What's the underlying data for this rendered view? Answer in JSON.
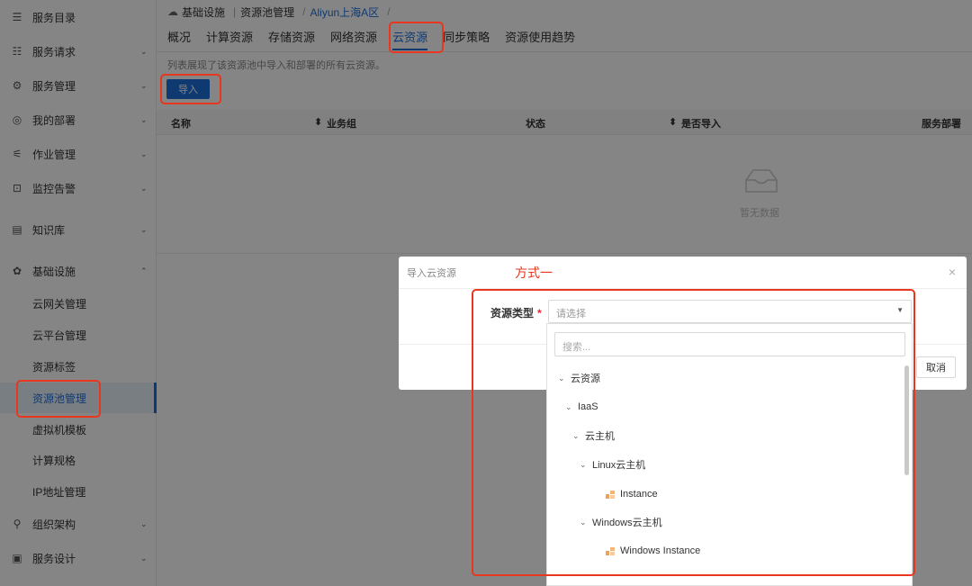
{
  "sidebar": {
    "items": [
      {
        "label": "服务目录",
        "icon": "catalog-icon",
        "chevron": ""
      },
      {
        "label": "服务请求",
        "icon": "request-icon",
        "chevron": "⌄"
      },
      {
        "label": "服务管理",
        "icon": "service-manage-icon",
        "chevron": "⌄"
      },
      {
        "label": "我的部署",
        "icon": "deploy-icon",
        "chevron": "⌄"
      },
      {
        "label": "作业管理",
        "icon": "job-icon",
        "chevron": "⌄"
      },
      {
        "label": "监控告警",
        "icon": "monitor-icon",
        "chevron": "⌄"
      },
      {
        "label": "知识库",
        "icon": "knowledge-icon",
        "chevron": "⌄"
      },
      {
        "label": "基础设施",
        "icon": "infra-icon",
        "chevron": "⌃"
      }
    ],
    "sub_items": [
      {
        "label": "云网关管理"
      },
      {
        "label": "云平台管理"
      },
      {
        "label": "资源标签"
      },
      {
        "label": "资源池管理"
      },
      {
        "label": "虚拟机模板"
      },
      {
        "label": "计算规格"
      },
      {
        "label": "IP地址管理"
      }
    ],
    "bottom_items": [
      {
        "label": "组织架构",
        "icon": "org-icon",
        "chevron": "⌄"
      },
      {
        "label": "服务设计",
        "icon": "design-icon",
        "chevron": "⌄"
      }
    ]
  },
  "breadcrumb": {
    "root": "基础设施",
    "level2": "资源池管理",
    "level3": "Aliyun上海A区",
    "trail_sep": "/"
  },
  "tabs": [
    {
      "label": "概况"
    },
    {
      "label": "计算资源"
    },
    {
      "label": "存储资源"
    },
    {
      "label": "网络资源"
    },
    {
      "label": "云资源"
    },
    {
      "label": "同步策略"
    },
    {
      "label": "资源使用趋势"
    }
  ],
  "description": "列表展现了该资源池中导入和部署的所有云资源。",
  "import_button": "导入",
  "table": {
    "columns": [
      "名称",
      "业务组",
      "状态",
      "是否导入",
      "服务部署"
    ],
    "empty_text": "暂无数据"
  },
  "modal": {
    "title": "导入云资源",
    "close": "×",
    "field_label": "资源类型",
    "required_mark": "*",
    "select_placeholder": "请选择",
    "cancel": "取消"
  },
  "dropdown": {
    "search_placeholder": "搜索...",
    "tree": [
      {
        "label": "云资源",
        "arrow": "⌄"
      },
      {
        "label": "IaaS",
        "arrow": "⌄"
      },
      {
        "label": "云主机",
        "arrow": "⌄"
      },
      {
        "label": "Linux云主机",
        "arrow": "⌄"
      },
      {
        "label": "Instance",
        "arrow": ""
      },
      {
        "label": "Windows云主机",
        "arrow": "⌄"
      },
      {
        "label": "Windows Instance",
        "arrow": ""
      }
    ]
  },
  "annotation": {
    "label": "方式一",
    "color": "#e8361f"
  },
  "colors": {
    "accent": "#1e6fd9",
    "overlay": "rgba(0,0,0,0.48)"
  }
}
